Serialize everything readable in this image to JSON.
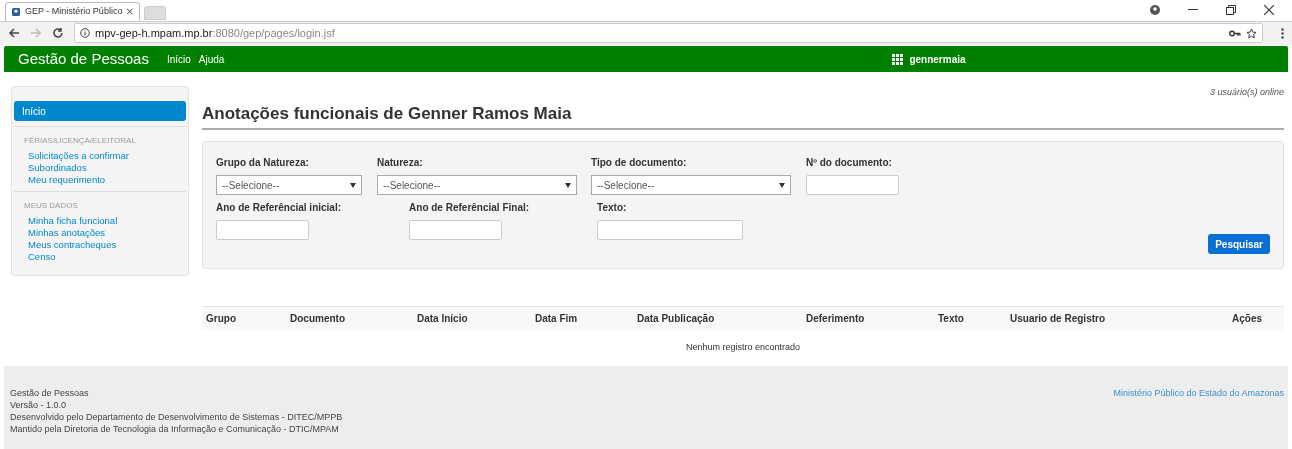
{
  "browser": {
    "tab_title": "GEP - Ministério Público",
    "url_host": "mpv-gep-h.mpam.mp.br",
    "url_path": ":8080/gep/pages/login.jsf"
  },
  "navbar": {
    "brand": "Gestão de Pessoas",
    "links": [
      "Início",
      "Ajuda"
    ],
    "user": "gennermaia"
  },
  "sidebar": {
    "top_item": {
      "label": "Início",
      "selected": true
    },
    "sections": [
      {
        "heading": "FÉRIAS/LICENÇA/ELEITORAL",
        "items": [
          "Solicitações a confirmar",
          "Subordinados",
          "Meu requerimento"
        ]
      },
      {
        "heading": "MEUS DADOS",
        "items": [
          "Minha ficha funcional",
          "Minhas anotações",
          "Meus contracheques",
          "Censo"
        ]
      }
    ]
  },
  "online_count": "3 usuário(s) online",
  "page_title": "Anotações funcionais de Genner Ramos Maia",
  "filters": {
    "row_1": [
      {
        "kind": "select",
        "label": "Grupo da Natureza:",
        "value": "--Selecione--"
      },
      {
        "kind": "select",
        "label": "Natureza:",
        "value": "--Selecione--"
      },
      {
        "kind": "select",
        "label": "Tipo de documento:",
        "value": "--Selecione--"
      },
      {
        "kind": "input",
        "label": "Nº do documento:"
      }
    ],
    "row_2": [
      {
        "kind": "input",
        "label": "Ano de Referêncial inicial:"
      },
      {
        "kind": "input",
        "label": "Ano de Referêncial Final:"
      },
      {
        "kind": "input",
        "label": "Texto:"
      }
    ],
    "search_button": "Pesquisar"
  },
  "table": {
    "columns": [
      "Grupo",
      "Documento",
      "Data Início",
      "Data Fim",
      "Data Publicação",
      "Deferimento",
      "Texto",
      "Usuario de Registro",
      "Ações"
    ],
    "empty_message": "Nenhum registro encontrado"
  },
  "footer": {
    "lines": [
      "Gestão de Pessoas",
      "Versão - 1.0.0",
      "Desenvolvido pelo Departamento de Desenvolvimento de Sistemas - DITEC/MPPB",
      "Mantido pela Diretoria de Tecnologia da Informação e Comunicação - DTIC/MPAM"
    ],
    "link": "Ministério Público do Estado do Amazonas"
  }
}
